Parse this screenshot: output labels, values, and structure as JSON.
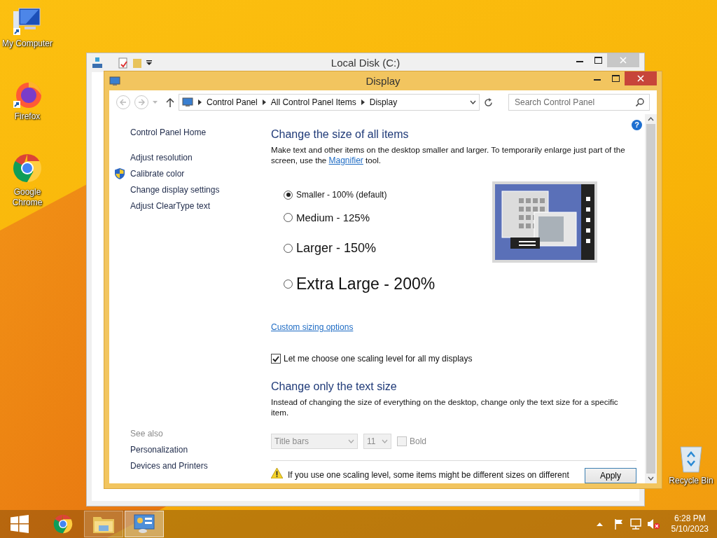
{
  "desktop_icons": [
    {
      "kind": "computer",
      "label": "My Computer"
    },
    {
      "kind": "firefox",
      "label": "Firefox"
    },
    {
      "kind": "chrome",
      "label": "Google Chrome"
    }
  ],
  "recycle_bin": {
    "label": "Recycle Bin"
  },
  "back_window": {
    "title": "Local Disk (C:)"
  },
  "window": {
    "title": "Display",
    "breadcrumb": [
      "Control Panel",
      "All Control Panel Items",
      "Display"
    ],
    "search": {
      "placeholder": "Search Control Panel"
    },
    "sidebar": {
      "home": "Control Panel Home",
      "items": [
        {
          "label": "Adjust resolution",
          "shield": false
        },
        {
          "label": "Calibrate color",
          "shield": true
        },
        {
          "label": "Change display settings",
          "shield": false
        },
        {
          "label": "Adjust ClearType text",
          "shield": false
        }
      ],
      "see_also": {
        "heading": "See also",
        "items": [
          "Personalization",
          "Devices and Printers"
        ]
      }
    },
    "main": {
      "help": "?",
      "heading": "Change the size of all items",
      "description": "Make text and other items on the desktop smaller and larger. To temporarily enlarge just part of the screen, use the ",
      "description_link": "Magnifier",
      "description_end": " tool.",
      "scaling_options": [
        {
          "label": "Smaller - 100% (default)",
          "selected": true
        },
        {
          "label": "Medium - 125%",
          "selected": false
        },
        {
          "label": "Larger - 150%",
          "selected": false
        },
        {
          "label": "Extra Large - 200%",
          "selected": false
        }
      ],
      "custom_link": "Custom sizing options",
      "one_level": {
        "label": "Let me choose one scaling level for all my displays",
        "checked": true
      },
      "text_size": {
        "heading": "Change only the text size",
        "description": "Instead of changing the size of everything on the desktop, change only the text size for a specific item.",
        "disabled": true,
        "element": "Title bars",
        "size": "11",
        "bold": {
          "label": "Bold",
          "checked": false
        }
      },
      "warning": "If you use one scaling level, some items might be different sizes on different",
      "apply": "Apply"
    }
  },
  "taskbar": {
    "apps": [
      {
        "kind": "chrome",
        "running": false,
        "selected": false
      },
      {
        "kind": "explorer",
        "running": true,
        "selected": false
      },
      {
        "kind": "control-panel",
        "running": true,
        "selected": true
      }
    ],
    "time": "6:28 PM",
    "date": "5/10/2023"
  }
}
